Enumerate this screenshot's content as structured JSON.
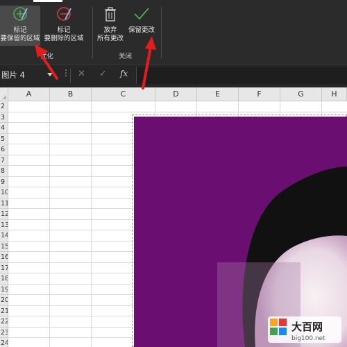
{
  "ribbon": {
    "buttons": [
      {
        "line1": "标记",
        "line2": "要保留的区域"
      },
      {
        "line1": "标记",
        "line2": "要删除的区域"
      },
      {
        "line1": "放弃",
        "line2": "所有更改"
      },
      {
        "line1": "保留更改",
        "line2": ""
      }
    ],
    "group_labels": {
      "optimize": "优化",
      "close": "关闭"
    }
  },
  "formula_bar": {
    "name_box": "图片 4",
    "dots": "⋮",
    "cancel": "✕",
    "enter": "✓",
    "fx": "fx"
  },
  "sheet": {
    "columns": [
      "A",
      "B",
      "C",
      "D",
      "E",
      "F",
      "G",
      "H"
    ],
    "rows": [
      "2",
      "3",
      "4",
      "5",
      "6",
      "7",
      "8",
      "9",
      "10",
      "11",
      "12",
      "13",
      "14",
      "15",
      "16",
      "17",
      "18",
      "19",
      "20",
      "21",
      "22",
      "23",
      "24"
    ]
  },
  "colors": {
    "photo_background": "#6a0f71",
    "annotation_arrow": "#e11d1d",
    "keep_icon": "#4caf50",
    "delete_icon": "#e53935"
  },
  "icons": [
    "mark-keep-icon",
    "mark-delete-icon",
    "discard-trash-icon",
    "keep-check-icon"
  ],
  "watermark": {
    "brand": "大百网",
    "url": "big100.net"
  }
}
